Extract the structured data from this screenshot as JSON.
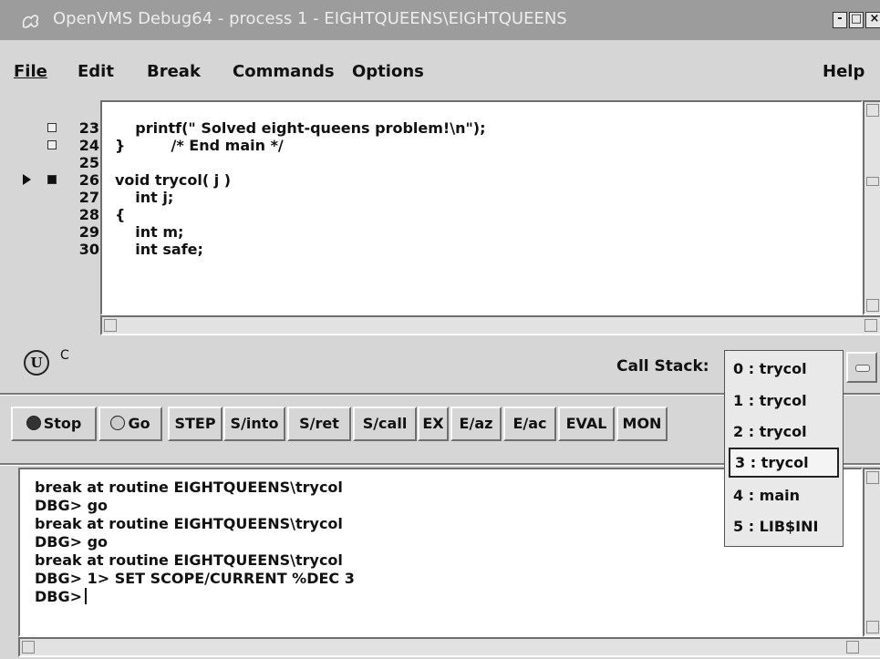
{
  "window": {
    "title": "OpenVMS Debug64 - process 1 - EIGHTQUEENS\\EIGHTQUEENS",
    "controls": {
      "minimize": "-",
      "maximize": "□",
      "close": "×"
    }
  },
  "menu": [
    {
      "label": "File"
    },
    {
      "label": "Edit"
    },
    {
      "label": "Break"
    },
    {
      "label": "Commands"
    },
    {
      "label": "Options"
    },
    {
      "label": "Help"
    }
  ],
  "source": {
    "lines": [
      {
        "num": "23",
        "text": "    printf(\" Solved eight-queens problem!\\n\");",
        "breakpoint": "empty"
      },
      {
        "num": "24",
        "text": "}         /* End main */",
        "breakpoint": "empty"
      },
      {
        "num": "25",
        "text": "",
        "breakpoint": "none"
      },
      {
        "num": "26",
        "text": "void trycol( j )",
        "breakpoint": "set",
        "current": true
      },
      {
        "num": "27",
        "text": "    int j;",
        "breakpoint": "none"
      },
      {
        "num": "28",
        "text": "{",
        "breakpoint": "none"
      },
      {
        "num": "29",
        "text": "    int m;",
        "breakpoint": "none"
      },
      {
        "num": "30",
        "text": "    int safe;",
        "breakpoint": "none"
      }
    ]
  },
  "status": {
    "mode_icon": "U",
    "language": "C",
    "callstack_label": "Call Stack:"
  },
  "callstack": {
    "items": [
      "0 : trycol",
      "1 : trycol",
      "2 : trycol",
      "3 : trycol",
      "4 : main",
      "5 : LIB$INI"
    ],
    "selected_index": 3
  },
  "toolbar": {
    "buttons": [
      "Stop",
      "Go",
      "STEP",
      "S/into",
      "S/ret",
      "S/call",
      "EX",
      "E/az",
      "E/ac",
      "EVAL",
      "MON"
    ]
  },
  "console": {
    "lines": [
      "break at routine EIGHTQUEENS\\trycol",
      "DBG> go",
      "break at routine EIGHTQUEENS\\trycol",
      "DBG> go",
      "break at routine EIGHTQUEENS\\trycol",
      "DBG> 1> SET SCOPE/CURRENT %DEC 3",
      "DBG>"
    ]
  }
}
